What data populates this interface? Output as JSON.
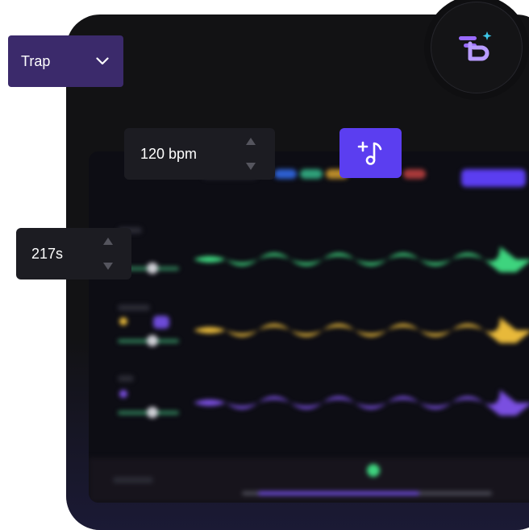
{
  "genre_dropdown": {
    "value": "Trap",
    "icon": "chevron-down-icon"
  },
  "bpm_stepper": {
    "value": "120 bpm"
  },
  "duration_stepper": {
    "value": "217s"
  },
  "add_music_button": {
    "icon": "music-note-plus-icon"
  },
  "logo": {
    "icon": "app-logo-icon"
  },
  "colors": {
    "accent": "#5b3ef0",
    "dropdown_bg": "#3b2a6b",
    "track_green": "#3ed47e",
    "track_yellow": "#e8b93a",
    "track_purple": "#7a4fe0"
  }
}
